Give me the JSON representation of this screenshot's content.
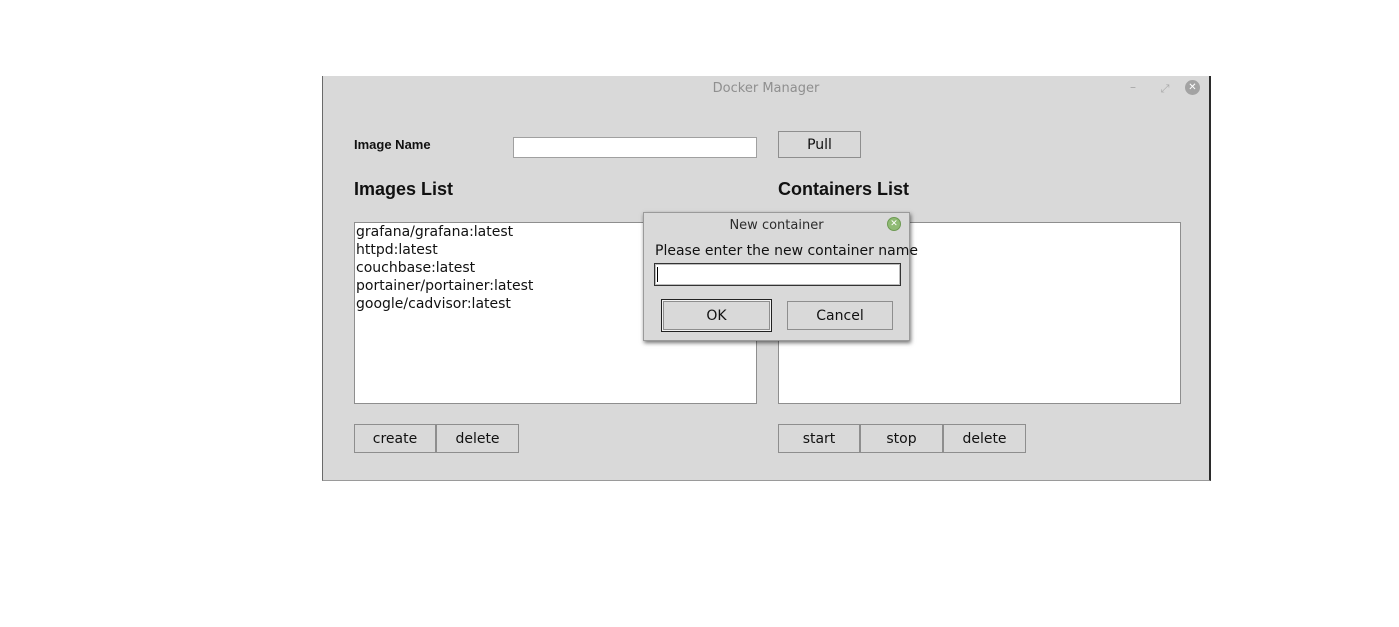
{
  "window": {
    "title": "Docker Manager",
    "min_glyph": "–",
    "max_glyph": "⤢",
    "close_glyph": "✕"
  },
  "pull_form": {
    "label": "Image Name",
    "input_value": "",
    "pull_label": "Pull"
  },
  "images": {
    "heading": "Images List",
    "items": [
      "grafana/grafana:latest",
      "httpd:latest",
      "couchbase:latest",
      "portainer/portainer:latest",
      "google/cadvisor:latest"
    ],
    "create_label": "create",
    "delete_label": "delete"
  },
  "containers": {
    "heading": "Containers List",
    "items": [],
    "start_label": "start",
    "stop_label": "stop",
    "delete_label": "delete"
  },
  "dialog": {
    "title": "New container",
    "close_glyph": "✕",
    "prompt": "Please enter the new container name",
    "input_value": "",
    "ok_label": "OK",
    "cancel_label": "Cancel"
  },
  "colors": {
    "window_bg": "#d9d9d9",
    "dialog_close": "#8fba74"
  }
}
